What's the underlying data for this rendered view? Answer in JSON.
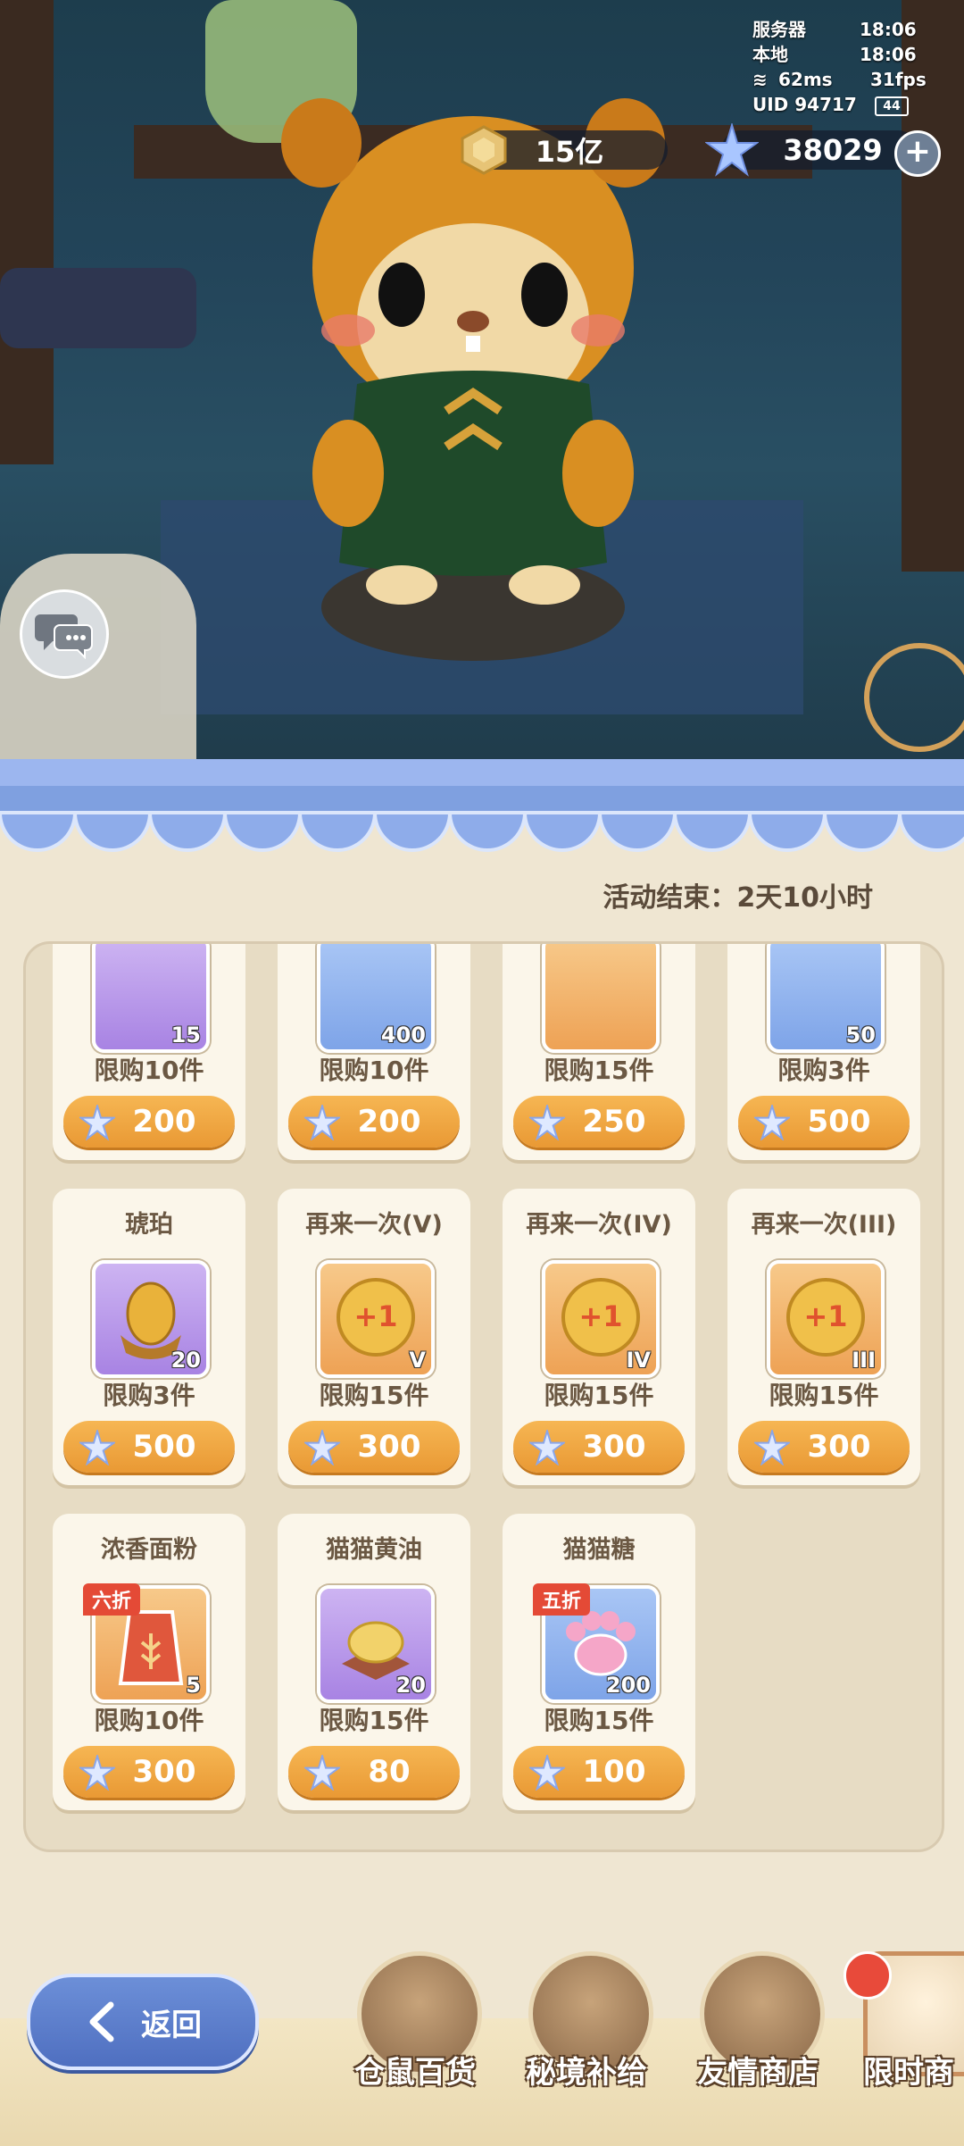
{
  "hud": {
    "coins": "15亿",
    "gems": "38029",
    "server_label": "服务器",
    "server_time": "18:06",
    "local_label": "本地",
    "local_time": "18:06",
    "ping": "62ms",
    "fps": "31fps",
    "uid": "UID 94717",
    "battery": "44"
  },
  "shop": {
    "timer": "活动结束：2天10小时",
    "items": [
      {
        "title": "",
        "count": "15",
        "limit": "限购10件",
        "price": "200",
        "icon": "potion-icon"
      },
      {
        "title": "",
        "count": "400",
        "limit": "限购10件",
        "price": "200",
        "icon": "meat-icon"
      },
      {
        "title": "",
        "count": "",
        "limit": "限购15件",
        "price": "250",
        "icon": "crystal-icon"
      },
      {
        "title": "",
        "count": "50",
        "limit": "限购3件",
        "price": "500",
        "icon": "amber-shard-icon"
      },
      {
        "title": "琥珀",
        "count": "20",
        "limit": "限购3件",
        "price": "500",
        "icon": "amber-icon"
      },
      {
        "title": "再来一次(V)",
        "count": "V",
        "limit": "限购15件",
        "price": "300",
        "icon": "plus-one-coin-icon"
      },
      {
        "title": "再来一次(IV)",
        "count": "IV",
        "limit": "限购15件",
        "price": "300",
        "icon": "plus-one-coin-icon"
      },
      {
        "title": "再来一次(III)",
        "count": "III",
        "limit": "限购15件",
        "price": "300",
        "icon": "plus-one-coin-icon"
      },
      {
        "title": "浓香面粉",
        "count": "5",
        "limit": "限购10件",
        "price": "300",
        "discount": "六折",
        "icon": "flour-bag-icon"
      },
      {
        "title": "猫猫黄油",
        "count": "20",
        "limit": "限购15件",
        "price": "80",
        "icon": "butter-icon"
      },
      {
        "title": "猫猫糖",
        "count": "200",
        "limit": "限购15件",
        "price": "100",
        "discount": "五折",
        "icon": "paw-candy-icon"
      }
    ]
  },
  "nav": {
    "back": "返回",
    "items": [
      "仓鼠百货",
      "秘境补给",
      "友情商店",
      "限时商"
    ]
  }
}
